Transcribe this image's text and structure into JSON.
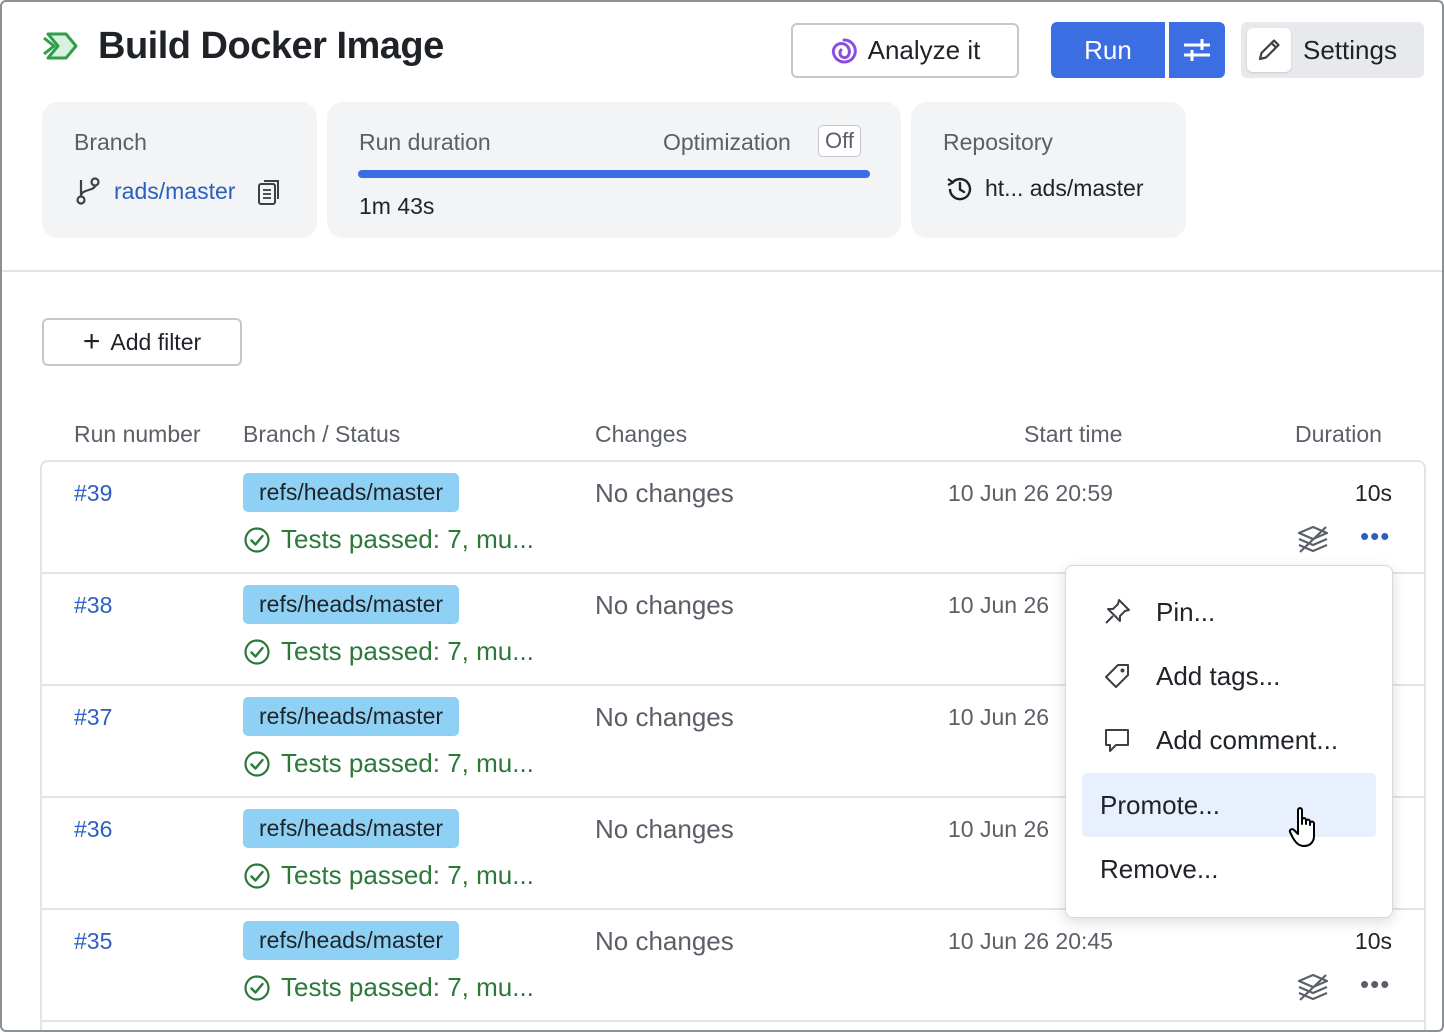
{
  "header": {
    "title": "Build Docker Image",
    "analyze_label": "Analyze it",
    "run_label": "Run",
    "settings_label": "Settings"
  },
  "cards": {
    "branch": {
      "label": "Branch",
      "value": "rads/master"
    },
    "duration": {
      "label": "Run duration",
      "optimization_label": "Optimization",
      "optimization_state": "Off",
      "value": "1m 43s"
    },
    "repository": {
      "label": "Repository",
      "value": "ht... ads/master"
    }
  },
  "filter": {
    "add_label": "Add filter"
  },
  "table": {
    "columns": [
      "Run number",
      "Branch / Status",
      "Changes",
      "Start time",
      "Duration"
    ],
    "rows": [
      {
        "number": "#39",
        "branch": "refs/heads/master",
        "status": "Tests passed: 7, mu...",
        "changes": "No changes",
        "start": "10 Jun 26 20:59",
        "duration": "10s"
      },
      {
        "number": "#38",
        "branch": "refs/heads/master",
        "status": "Tests passed: 7, mu...",
        "changes": "No changes",
        "start": "10 Jun 26",
        "duration": ""
      },
      {
        "number": "#37",
        "branch": "refs/heads/master",
        "status": "Tests passed: 7, mu...",
        "changes": "No changes",
        "start": "10 Jun 26",
        "duration": ""
      },
      {
        "number": "#36",
        "branch": "refs/heads/master",
        "status": "Tests passed: 7, mu...",
        "changes": "No changes",
        "start": "10 Jun 26",
        "duration": ""
      },
      {
        "number": "#35",
        "branch": "refs/heads/master",
        "status": "Tests passed: 7, mu...",
        "changes": "No changes",
        "start": "10 Jun 26 20:45",
        "duration": "10s"
      }
    ]
  },
  "menu": {
    "items": [
      "Pin...",
      "Add tags...",
      "Add comment...",
      "Promote...",
      "Remove..."
    ],
    "highlighted": "Promote..."
  },
  "colors": {
    "accent": "#3a6ee2",
    "link": "#2b5fbf",
    "success": "#2b7a3a",
    "branch_tag": "#8fd1f5",
    "menu_hover": "#e8f0fd"
  }
}
